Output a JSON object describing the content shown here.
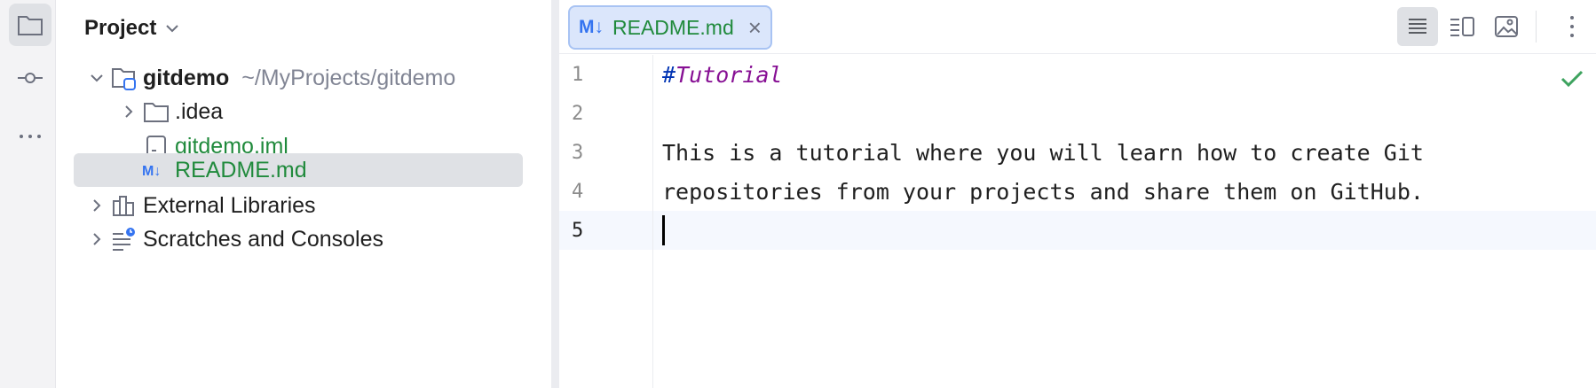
{
  "toolstrip": {
    "items": [
      {
        "icon": "folder-icon",
        "active": true
      },
      {
        "icon": "commit-icon",
        "active": false
      },
      {
        "icon": "more-horizontal-icon",
        "active": false
      }
    ]
  },
  "project": {
    "title": "Project",
    "tree": {
      "root_name": "gitdemo",
      "root_path": "~/MyProjects/gitdemo",
      "idea": ".idea",
      "iml": "gitdemo.iml",
      "readme": "README.md",
      "external_libraries": "External Libraries",
      "scratches": "Scratches and Consoles"
    }
  },
  "editor": {
    "tab": {
      "badge": "M↓",
      "label": "README.md"
    },
    "view_modes": [
      "editor-only-icon",
      "editor-and-preview-icon",
      "preview-only-icon"
    ],
    "line_numbers": [
      "1",
      "2",
      "3",
      "4",
      "5"
    ],
    "lines": {
      "l1_hash": "#",
      "l1_text": "Tutorial",
      "l3": "This is a tutorial where you will learn how to create Git",
      "l4": "repositories from your projects and share them on GitHub."
    },
    "inspection_status": "check-icon"
  },
  "colors": {
    "accent_blue": "#3574f0",
    "vcs_added_green": "#208a3c",
    "markdown_heading": "#871094"
  }
}
